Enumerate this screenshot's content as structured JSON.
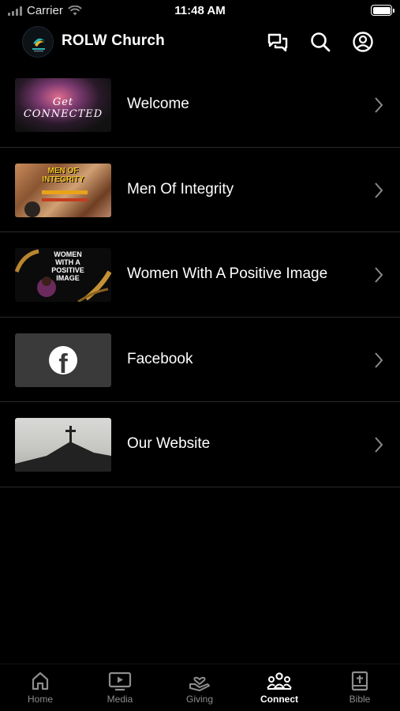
{
  "status": {
    "carrier": "Carrier",
    "time": "11:48 AM"
  },
  "header": {
    "title": "ROLW Church"
  },
  "items": [
    {
      "label": "Welcome",
      "thumb_text": "Get CONNECTED"
    },
    {
      "label": "Men Of Integrity",
      "thumb_text": "MEN OF INTEGRITY"
    },
    {
      "label": "Women With A Positive Image",
      "thumb_text": "WOMEN WITH A POSITIVE IMAGE"
    },
    {
      "label": "Facebook",
      "thumb_text": "f"
    },
    {
      "label": "Our Website",
      "thumb_text": ""
    }
  ],
  "tabs": [
    {
      "label": "Home",
      "icon": "home-icon"
    },
    {
      "label": "Media",
      "icon": "tv-icon"
    },
    {
      "label": "Giving",
      "icon": "hand-heart-icon"
    },
    {
      "label": "Connect",
      "icon": "people-icon",
      "active": true
    },
    {
      "label": "Bible",
      "icon": "bible-icon"
    }
  ],
  "colors": {
    "background": "#000000",
    "text": "#ffffff",
    "muted": "#8d8d8d",
    "divider": "#2a2a2a"
  }
}
